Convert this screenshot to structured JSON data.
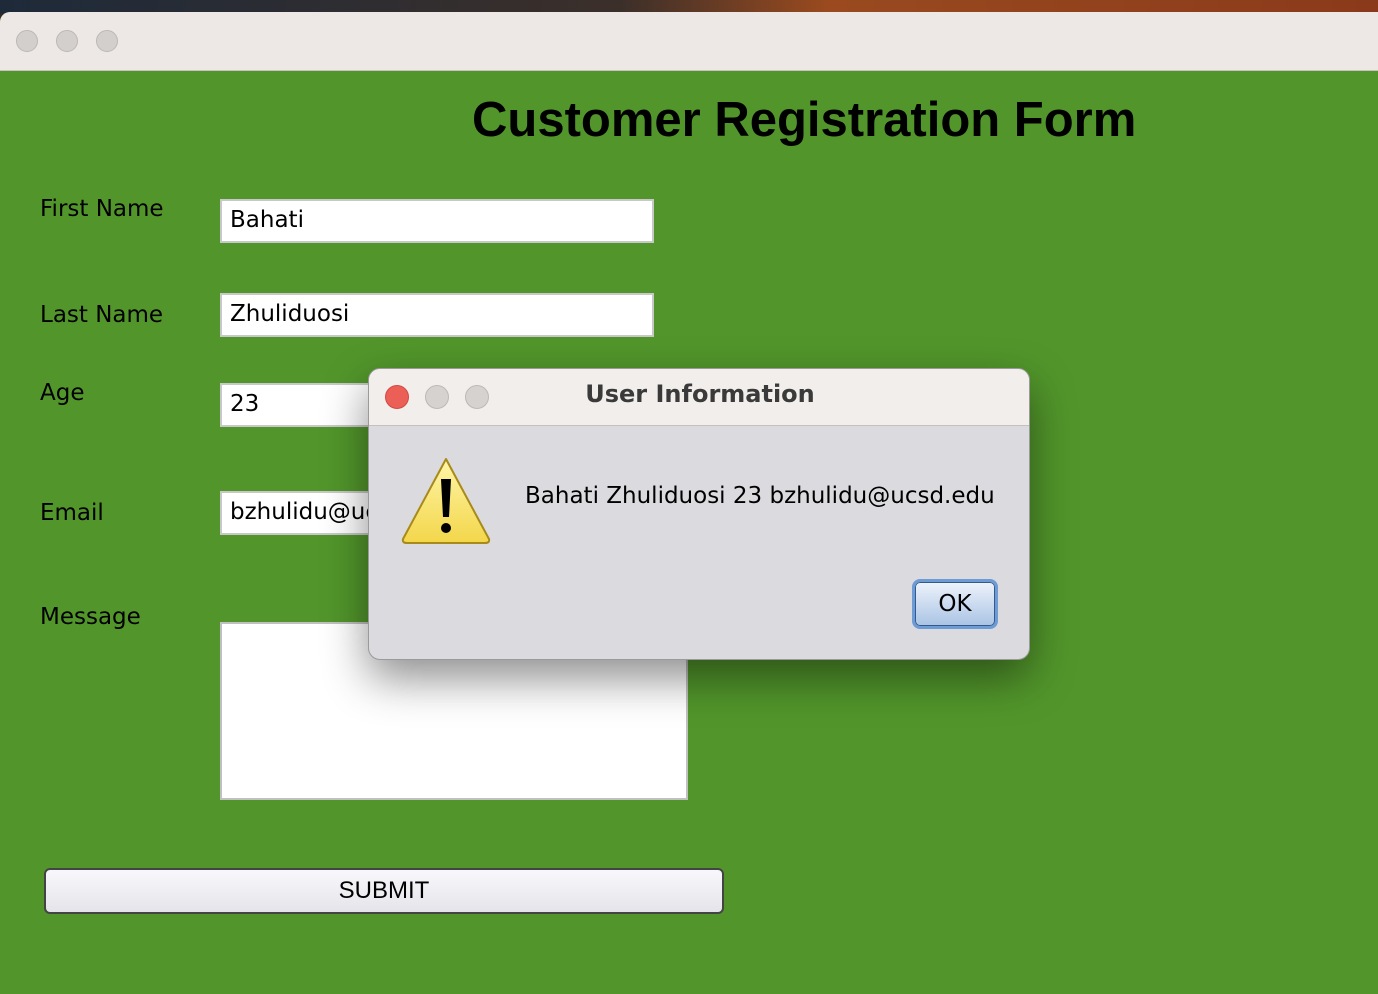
{
  "form": {
    "heading": "Customer Registration Form",
    "first_name_label": "First Name",
    "first_name_value": "Bahati",
    "last_name_label": "Last Name",
    "last_name_value": "Zhuliduosi",
    "age_label": "Age",
    "age_value": "23",
    "email_label": "Email",
    "email_value_visible": "bzhulidu@uc",
    "message_label": "Message",
    "message_value": "",
    "submit_label": "SUBMIT"
  },
  "dialog": {
    "title": "User Information",
    "message": "Bahati Zhuliduosi 23 bzhulidu@ucsd.edu",
    "icon": "warning-icon",
    "ok_label": "OK"
  },
  "colors": {
    "window_background": "#52962b",
    "close_button": "#ec5f57"
  }
}
